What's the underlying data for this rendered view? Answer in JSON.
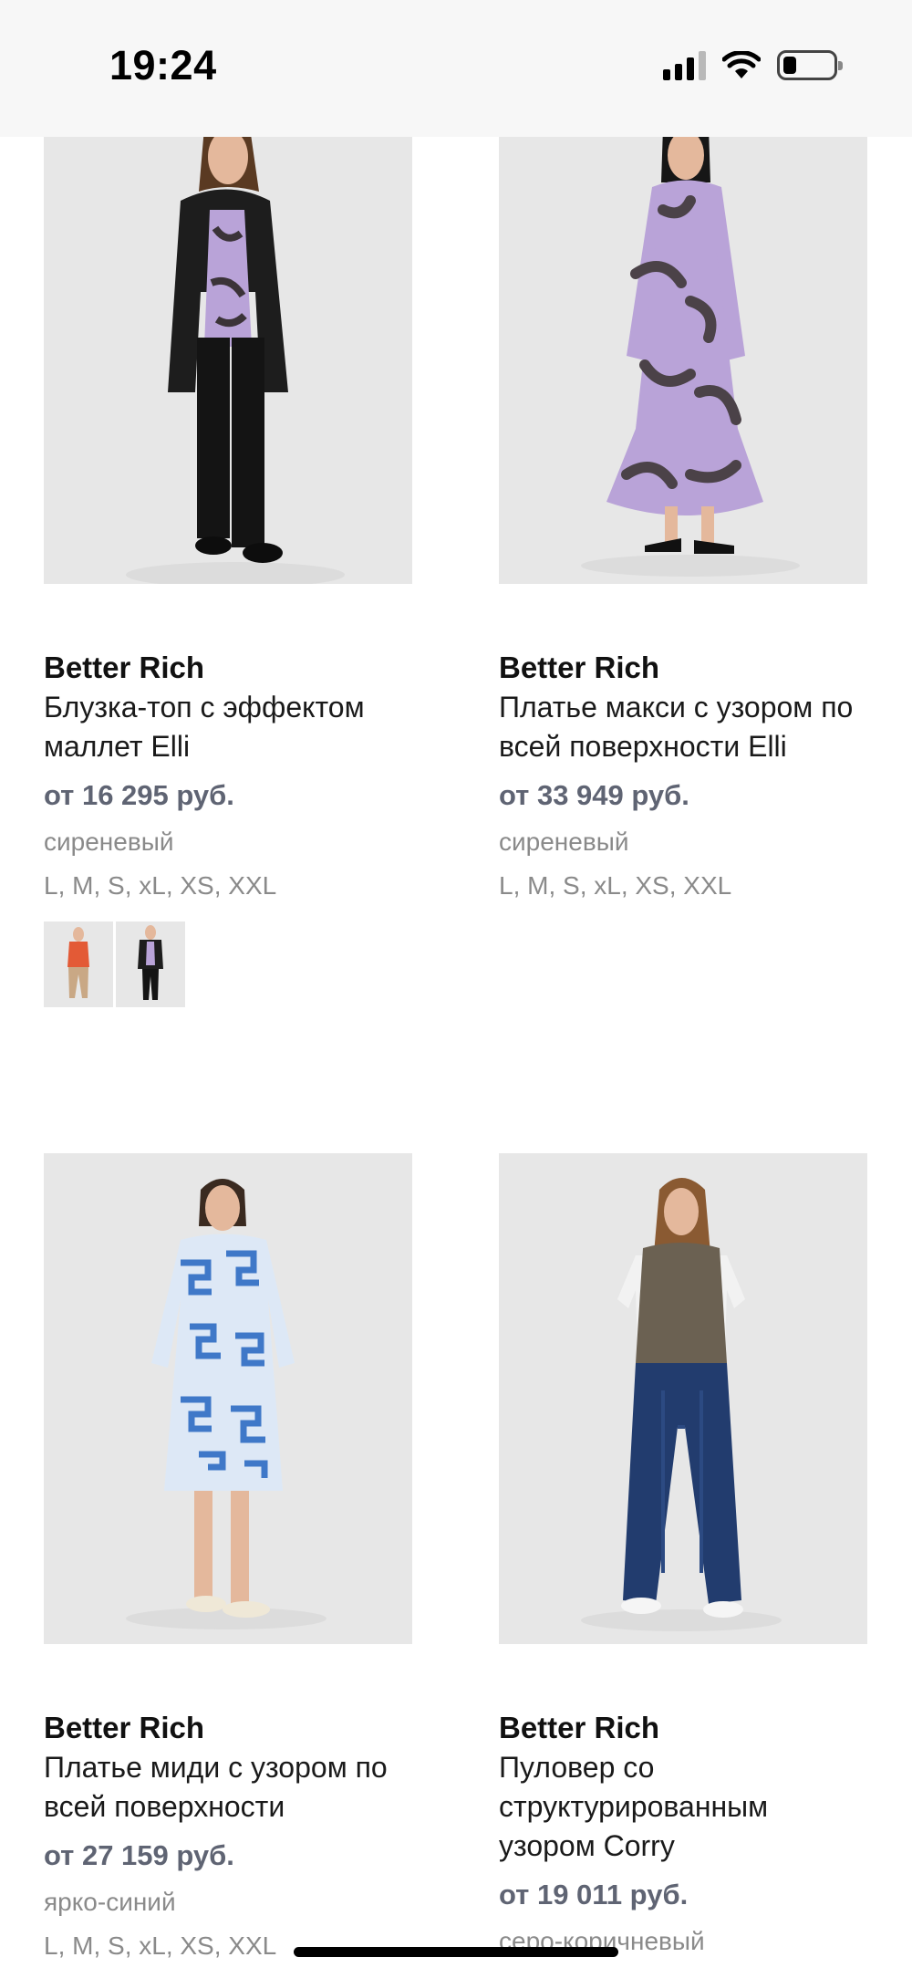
{
  "status_bar": {
    "time": "19:24"
  },
  "products": [
    {
      "brand": "Better Rich",
      "title": "Блузка-топ с эффектом маллет Elli",
      "price": "от 16 295 руб.",
      "color": "сиреневый",
      "sizes": "L, M, S, xL, XS, XXL"
    },
    {
      "brand": "Better Rich",
      "title": "Платье макси с узором по всей поверхности Elli",
      "price": "от 33 949 руб.",
      "color": "сиреневый",
      "sizes": "L, M, S, xL, XS, XXL"
    },
    {
      "brand": "Better Rich",
      "title": "Платье миди с узором по всей поверхности",
      "price": "от 27 159 руб.",
      "color": "ярко-синий",
      "sizes": "L, M, S, xL, XS, XXL"
    },
    {
      "brand": "Better Rich",
      "title": "Пуловер со структурированным узором Corry",
      "price": "от 19 011 руб.",
      "color": "серо-коричневый",
      "sizes": ""
    }
  ]
}
